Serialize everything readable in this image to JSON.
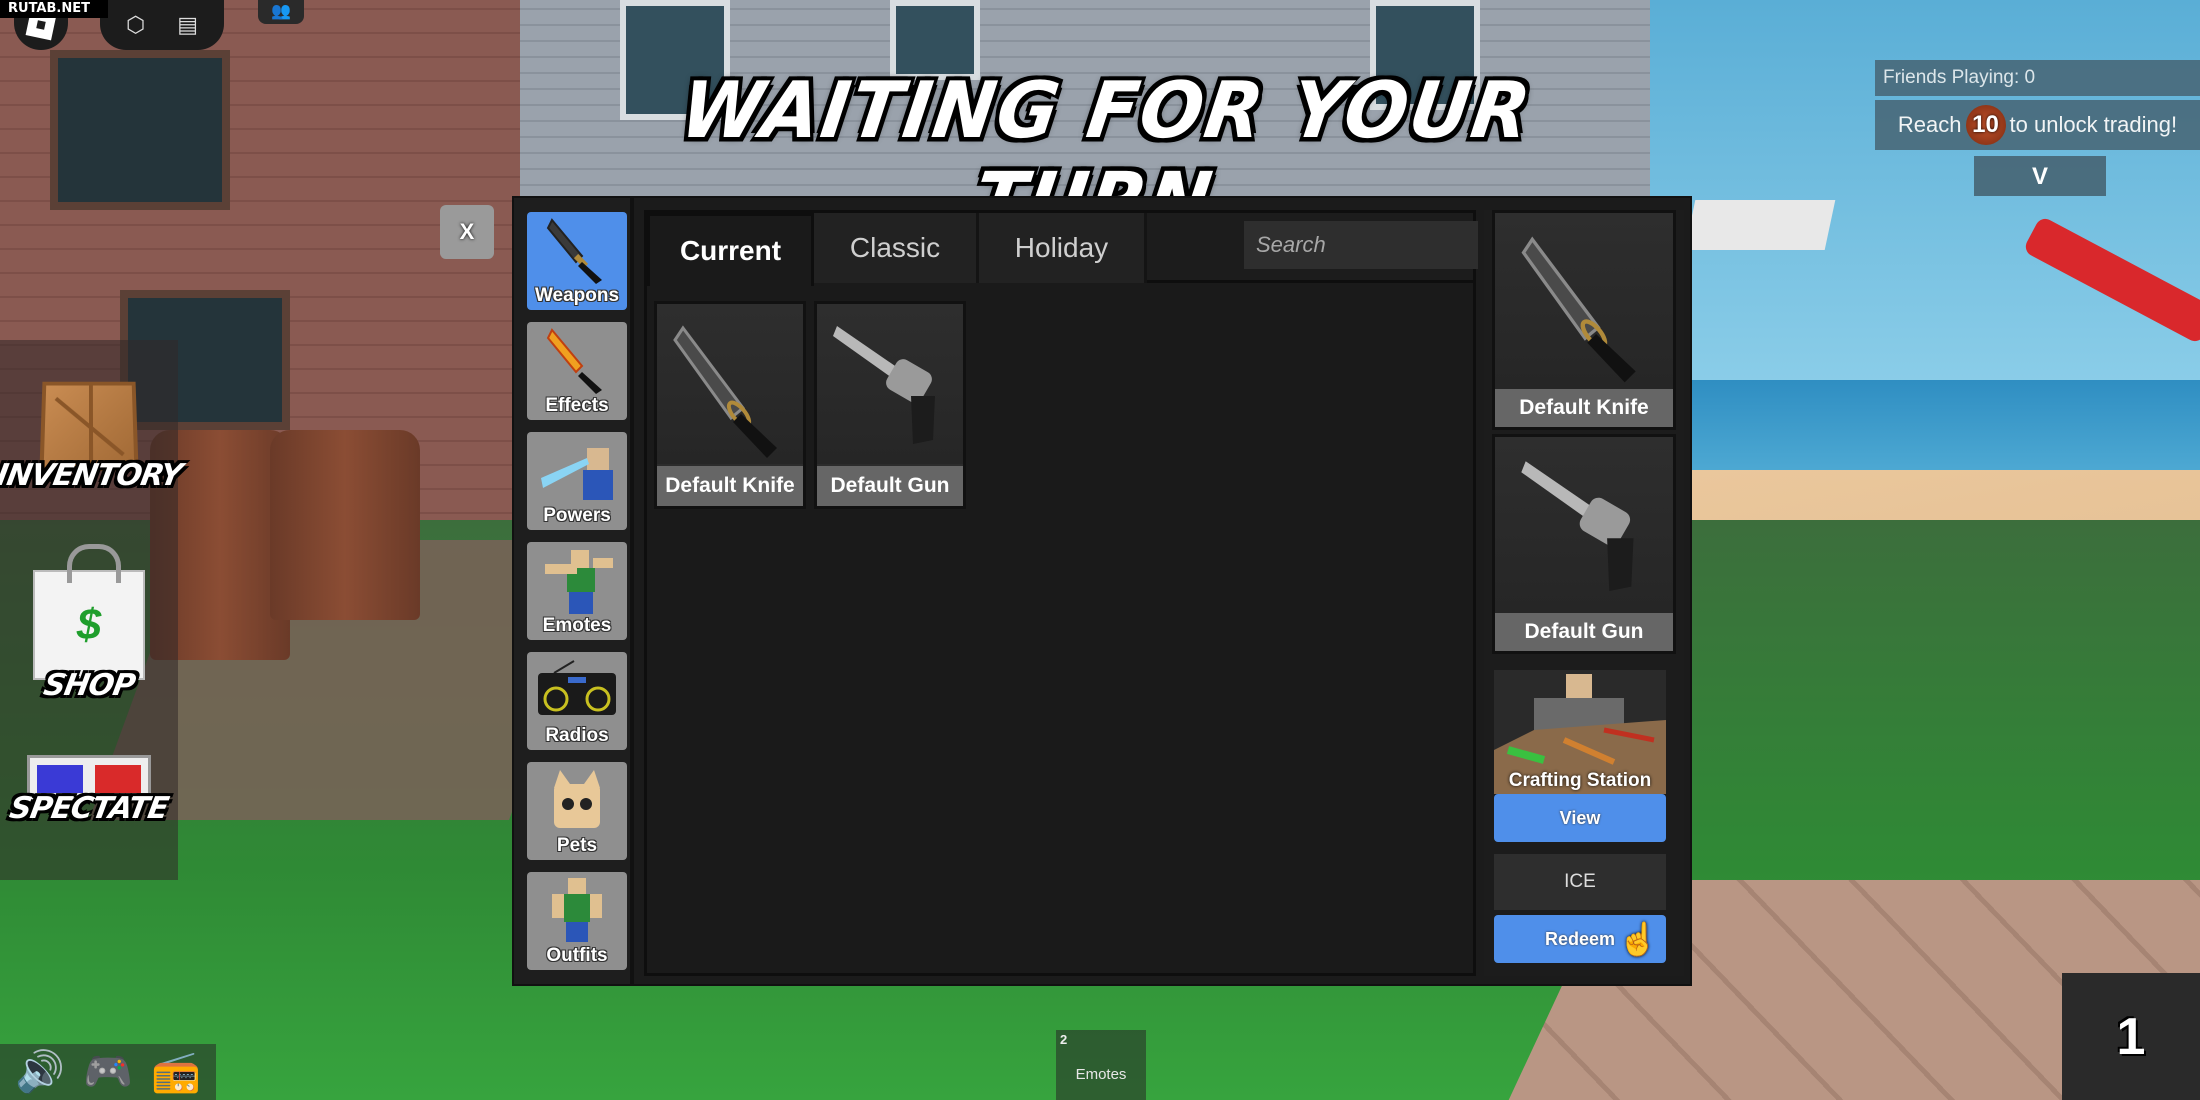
{
  "watermark": "RUTAB.NET",
  "roblox_topbar": {
    "menu_icon": "roblox-logo-icon",
    "pill_icons": [
      "backpack-icon",
      "chat-icon"
    ],
    "friends_icon": "friends-icon"
  },
  "banner": "WAITING FOR YOUR TURN",
  "top_right": {
    "friends_playing": "Friends Playing: 0",
    "trade_prefix": "Reach",
    "trade_level": "10",
    "trade_suffix": "to unlock trading!",
    "expand_label": "V"
  },
  "left_hud": [
    {
      "label": "INVENTORY",
      "icon": "crate-icon"
    },
    {
      "label": "SHOP",
      "icon": "shopping-bag-icon",
      "icon_glyph": "$"
    },
    {
      "label": "SPECTATE",
      "icon": "3d-glasses-icon"
    }
  ],
  "inventory": {
    "close_label": "X",
    "categories": [
      {
        "label": "Weapons",
        "icon": "knife-icon",
        "active": true
      },
      {
        "label": "Effects",
        "icon": "flaming-knife-icon",
        "active": false
      },
      {
        "label": "Powers",
        "icon": "power-beam-icon",
        "active": false
      },
      {
        "label": "Emotes",
        "icon": "dab-emote-icon",
        "active": false
      },
      {
        "label": "Radios",
        "icon": "boombox-icon",
        "active": false
      },
      {
        "label": "Pets",
        "icon": "cat-pet-icon",
        "active": false
      },
      {
        "label": "Outfits",
        "icon": "outfit-avatar-icon",
        "active": false
      }
    ],
    "tabs": [
      {
        "label": "Current",
        "active": true
      },
      {
        "label": "Classic",
        "active": false
      },
      {
        "label": "Holiday",
        "active": false
      }
    ],
    "search": {
      "placeholder": "Search",
      "value": ""
    },
    "items": [
      {
        "name": "Default Knife",
        "icon": "knife-icon"
      },
      {
        "name": "Default Gun",
        "icon": "revolver-icon"
      }
    ],
    "equipped": [
      {
        "name": "Default Knife",
        "icon": "knife-icon"
      },
      {
        "name": "Default Gun",
        "icon": "revolver-icon"
      }
    ],
    "crafting": {
      "label": "Crafting Station",
      "view_label": "View"
    },
    "code": {
      "value": "ICE",
      "redeem_label": "Redeem"
    }
  },
  "bottom_hud": {
    "icons": [
      "speaker-icon",
      "gamepad-icon",
      "boombox-icon"
    ],
    "hotbar": {
      "slot_number": "2",
      "label": "Emotes"
    },
    "round_counter": "1"
  },
  "colors": {
    "accent_blue": "#4f8fea",
    "panel_dark": "#1b1b1b",
    "tile_gray": "#8f8f8f",
    "label_gray": "#666666"
  }
}
